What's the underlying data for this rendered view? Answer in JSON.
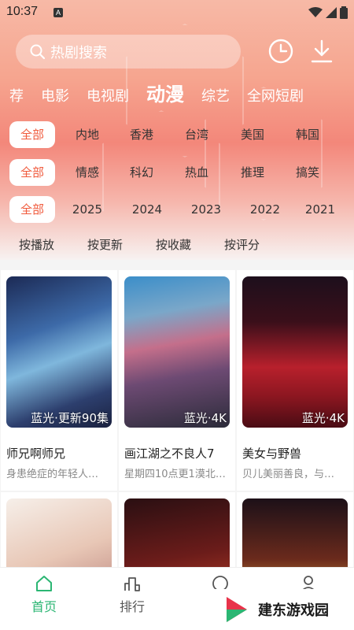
{
  "status": {
    "time": "10:37",
    "indicator": "A"
  },
  "search": {
    "placeholder": "热剧搜索"
  },
  "header_icons": [
    "history-clock-icon",
    "download-icon"
  ],
  "categories": [
    {
      "label": "荐"
    },
    {
      "label": "电影"
    },
    {
      "label": "电视剧"
    },
    {
      "label": "动漫",
      "active": true
    },
    {
      "label": "综艺"
    },
    {
      "label": "全网短剧"
    }
  ],
  "filters": {
    "region": [
      "全部",
      "内地",
      "香港",
      "台湾",
      "美国",
      "韩国"
    ],
    "genre": [
      "全部",
      "情感",
      "科幻",
      "热血",
      "推理",
      "搞笑"
    ],
    "year": [
      "全部",
      "2025",
      "2024",
      "2023",
      "2022",
      "2021"
    ]
  },
  "sort": [
    "按播放",
    "按更新",
    "按收藏",
    "按评分"
  ],
  "cards": [
    {
      "title": "师兄啊师兄",
      "desc": "身患绝症的年轻人…",
      "badge": "蓝光·更新90集"
    },
    {
      "title": "画江湖之不良人7",
      "desc": "星期四10点更1漠北…",
      "badge": "蓝光·4K"
    },
    {
      "title": "美女与野兽",
      "desc": "贝儿美丽善良，与…",
      "badge": "蓝光·4K"
    },
    {
      "title": "",
      "desc": "",
      "badge": ""
    },
    {
      "title": "",
      "desc": "",
      "badge": ""
    },
    {
      "title": "",
      "desc": "",
      "badge": ""
    }
  ],
  "nav": [
    {
      "label": "首页",
      "active": true
    },
    {
      "label": "排行"
    },
    {
      "label": ""
    },
    {
      "label": ""
    }
  ],
  "watermark": {
    "text": "建东游戏园"
  },
  "colors": {
    "accent": "#f05a3c",
    "nav_active": "#2bb673",
    "header_top": "#f7b9a6",
    "header_mid": "#f3877a"
  }
}
